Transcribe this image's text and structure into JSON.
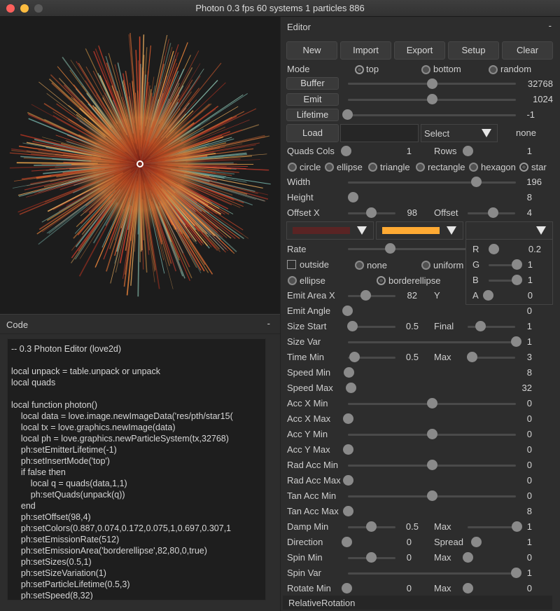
{
  "window": {
    "title": "Photon 0.3 fps 60 systems 1 particles 886"
  },
  "code_panel": {
    "title": "Code",
    "collapse": "-",
    "lines": [
      "-- 0.3 Photon Editor (love2d)",
      "",
      "local unpack = table.unpack or unpack",
      "local quads",
      "",
      "local function photon()",
      "    local data = love.image.newImageData('res/pth/star15(",
      "    local tx = love.graphics.newImage(data)",
      "    local ph = love.graphics.newParticleSystem(tx,32768)",
      "    ph:setEmitterLifetime(-1)",
      "    ph:setInsertMode('top')",
      "    if false then",
      "        local q = quads(data,1,1)",
      "        ph:setQuads(unpack(q))",
      "    end",
      "    ph:setOffset(98,4)",
      "    ph:setColors(0.887,0.074,0.172,0.075,1,0.697,0.307,1",
      "    ph:setEmissionRate(512)",
      "    ph:setEmissionArea('borderellipse',82,80,0,true)",
      "    ph:setSizes(0.5,1)",
      "    ph:setSizeVariation(1)",
      "    ph:setParticleLifetime(0.5,3)",
      "    ph:setSpeed(8,32)"
    ]
  },
  "editor": {
    "title": "Editor",
    "collapse": "-",
    "toolbar": {
      "new": "New",
      "import": "Import",
      "export": "Export",
      "setup": "Setup",
      "clear": "Clear"
    },
    "mode": {
      "label": "Mode",
      "options": [
        "top",
        "bottom",
        "random"
      ],
      "selected": "top"
    },
    "buffer": {
      "label": "Buffer",
      "value": "32768",
      "level": 0.56
    },
    "emit": {
      "label": "Emit",
      "value": "1024",
      "level": 0.56
    },
    "lifetime": {
      "label": "Lifetime",
      "value": "-1",
      "level": 0.0
    },
    "load": {
      "label": "Load",
      "select": "Select",
      "value": "none"
    },
    "quads": {
      "cols_label": "Quads Cols",
      "cols_value": "1",
      "rows_label": "Rows",
      "rows_value": "1"
    },
    "shapes": [
      "circle",
      "ellipse",
      "triangle",
      "rectangle",
      "hexagon",
      "star"
    ],
    "shape_selected": "star",
    "width": {
      "label": "Width",
      "value": "196"
    },
    "height": {
      "label": "Height",
      "value": "8"
    },
    "offset_x": {
      "label": "Offset X",
      "value": "98"
    },
    "offset_y": {
      "label": "Offset",
      "value": "4"
    },
    "colors": {
      "c1": "#5a2424",
      "c2": "#ffaa33"
    },
    "rate": {
      "label": "Rate"
    },
    "area": {
      "outside": "outside",
      "options": [
        "none",
        "uniform",
        "ellipse",
        "borderellipse"
      ],
      "selected": "borderellipse"
    },
    "picker": {
      "r_label": "R",
      "r": "0.2",
      "g_label": "G",
      "g": "1",
      "b_label": "B",
      "b": "1",
      "a_label": "A",
      "a": "0"
    },
    "emit_area": {
      "label": "Emit Area X",
      "value": "82",
      "y_label": "Y"
    },
    "emit_angle": {
      "label": "Emit Angle",
      "value": "0"
    },
    "size_start": {
      "label": "Size Start",
      "value": "0.5",
      "final_label": "Final",
      "final_value": "1"
    },
    "size_var": {
      "label": "Size Var",
      "value": "1"
    },
    "time_min": {
      "label": "Time Min",
      "value": "0.5",
      "max_label": "Max",
      "max_value": "3"
    },
    "speed_min": {
      "label": "Speed Min",
      "value": "8"
    },
    "speed_max": {
      "label": "Speed Max",
      "value": "32"
    },
    "acc_x_min": {
      "label": "Acc X Min",
      "value": "0"
    },
    "acc_x_max": {
      "label": "Acc X Max",
      "value": "0"
    },
    "acc_y_min": {
      "label": "Acc Y Min",
      "value": "0"
    },
    "acc_y_max": {
      "label": "Acc Y Max",
      "value": "0"
    },
    "rad_acc_min": {
      "label": "Rad Acc Min",
      "value": "0"
    },
    "rad_acc_max": {
      "label": "Rad Acc Max",
      "value": "0"
    },
    "tan_acc_min": {
      "label": "Tan Acc Min",
      "value": "0"
    },
    "tan_acc_max": {
      "label": "Tan Acc Max",
      "value": "8"
    },
    "damp_min": {
      "label": "Damp Min",
      "value": "0.5",
      "max_label": "Max",
      "max_value": "1"
    },
    "direction": {
      "label": "Direction",
      "value": "0",
      "spread_label": "Spread",
      "spread_value": "1"
    },
    "spin_min": {
      "label": "Spin Min",
      "value": "0",
      "max_label": "Max",
      "max_value": "0"
    },
    "spin_var": {
      "label": "Spin Var",
      "value": "1"
    },
    "rotate_min": {
      "label": "Rotate Min",
      "value": "0",
      "max_label": "Max",
      "max_value": "0"
    },
    "relative_rotation": {
      "label": "RelativeRotation"
    }
  }
}
